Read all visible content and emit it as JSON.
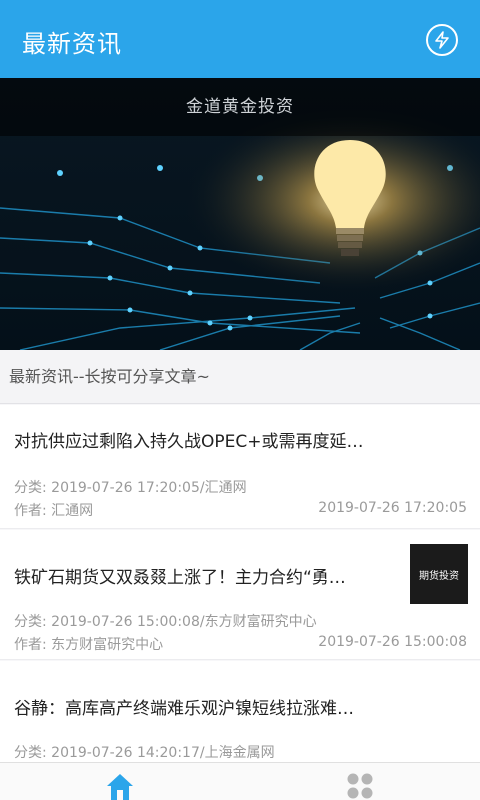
{
  "header": {
    "title": "最新资讯",
    "action_icon": "lightning-icon"
  },
  "banner": {
    "caption": "金道黄金投资"
  },
  "section": {
    "title": "最新资讯--长按可分享文章~"
  },
  "news": [
    {
      "title": "对抗供应过剩陷入持久战OPEC+或需再度延…",
      "category": "分类: 2019-07-26 17:20:05/汇通网",
      "author": "作者: 汇通网",
      "date": "2019-07-26 17:20:05"
    },
    {
      "title": "铁矿石期货又双叒叕上涨了！主力合约“勇…",
      "category": "分类: 2019-07-26 15:00:08/东方财富研究中心",
      "author": "作者: 东方财富研究中心",
      "date": "2019-07-26 15:00:08",
      "thumb": "期货投资"
    },
    {
      "title": "谷静：高库高产终端难乐观沪镍短线拉涨难…",
      "category": "分类: 2019-07-26 14:20:17/上海金属网"
    }
  ],
  "tabbar": {
    "active_color": "#2ba5ea",
    "inactive_color": "#b5b5b5",
    "tabs": [
      "home-icon",
      "grid-icon"
    ]
  }
}
